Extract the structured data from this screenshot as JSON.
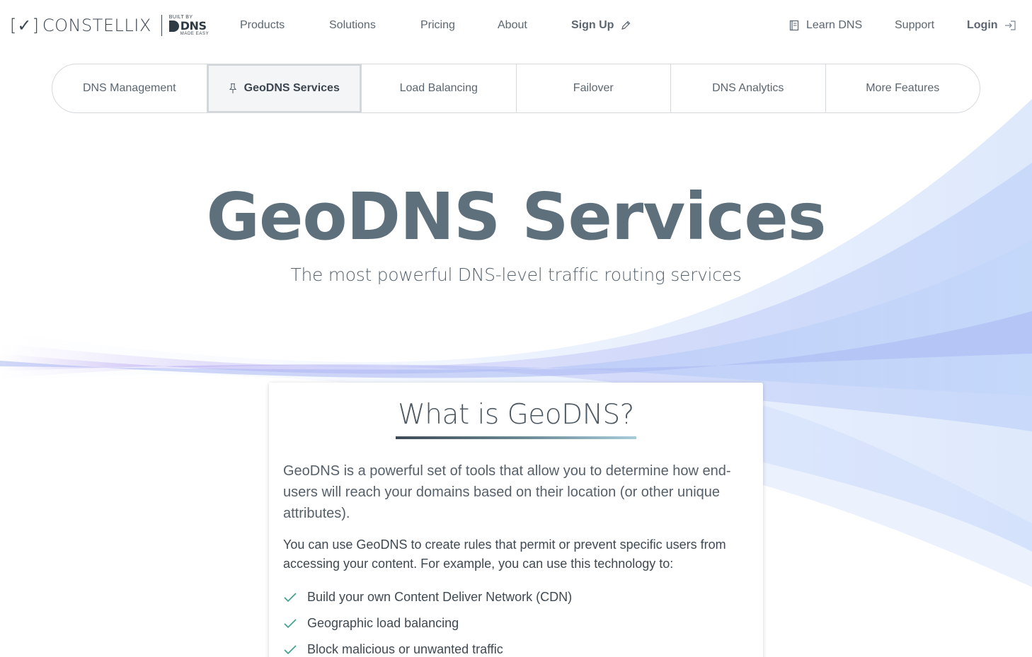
{
  "brand": {
    "mark": "[✓]",
    "name": "CONSTELLIX",
    "built_by": "BUILT BY",
    "dns_text": "DNS",
    "made_easy": "MADE EASY"
  },
  "nav": {
    "products": "Products",
    "solutions": "Solutions",
    "pricing": "Pricing",
    "about": "About",
    "signup": "Sign Up",
    "learn_dns": "Learn DNS",
    "support": "Support",
    "login": "Login"
  },
  "subtabs": [
    {
      "label": "DNS Management",
      "active": false
    },
    {
      "label": "GeoDNS Services",
      "active": true
    },
    {
      "label": "Load Balancing",
      "active": false
    },
    {
      "label": "Failover",
      "active": false
    },
    {
      "label": "DNS Analytics",
      "active": false
    },
    {
      "label": "More Features",
      "active": false
    }
  ],
  "hero": {
    "title": "GeoDNS Services",
    "subtitle": "The most powerful DNS-level traffic routing services"
  },
  "card": {
    "title": "What is GeoDNS?",
    "para1": "GeoDNS is a powerful set of tools that allow you to determine how end-users will reach your domains based on their location (or other unique attributes).",
    "para2": "You can use GeoDNS to create rules that permit or prevent specific users from accessing your content. For example, you can use this technology to:",
    "list": [
      "Build your own Content Deliver Network (CDN)",
      "Geographic load balancing",
      "Block malicious or unwanted traffic"
    ]
  },
  "colors": {
    "text_dark": "#3c4650",
    "text_muted": "#5b6670",
    "hero_title": "#5f707d",
    "check": "#3aa08a",
    "swirl_blue": "#8fb3f0",
    "swirl_purple": "#b7a8f0"
  },
  "icons": {
    "signup": "pencil-icon",
    "learn_dns": "book-icon",
    "login": "sign-in-icon",
    "active_tab": "pin-icon",
    "list_bullet": "check-icon"
  }
}
